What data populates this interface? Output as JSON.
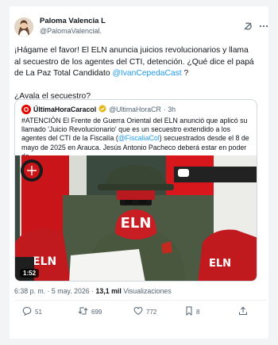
{
  "author": {
    "display_name": "Paloma Valencia L",
    "handle": "@PalomaValencial."
  },
  "tweet": {
    "text_part1": "¡Hágame el favor! El ELN anuncia juicios revolucionarios y llama al secuestro de los agentes del CTI, detención. ¿Qué dice el papá de La Paz Total Candidato ",
    "mention": "@IvanCepedaCast",
    "text_part1_end": " ?",
    "text_part2": "¿Avala el secuestro?"
  },
  "quote": {
    "name": "ÚltimaHoraCaracol",
    "handle": "@UltimaHoraCR",
    "time": "· 3h",
    "text_a": "#ATENCIÓN El Frente de Guerra Oriental del ELN anunció que aplicó su llamado 'Juicio Revolucionario' que es un secuestro extendido a los agentes del CTI de la Fiscalía (",
    "mention": "@FiscaliaCol",
    "text_b": ") secuestrados desde el 8 de mayo de 2025 en Arauca. Jesús Antonio Pacheco deberá estar en poder de",
    "video_duration": "1:52",
    "video_patch_text": "ELN"
  },
  "meta": {
    "time_date": "6:38 p. m. · 5 may. 2026 · ",
    "views_count": "13,1 mil",
    "views_label": "Visualizaciones"
  },
  "actions": {
    "replies": "51",
    "reposts": "699",
    "likes": "772",
    "bookmarks": "8"
  },
  "colors": {
    "accent": "#1d9bf0",
    "secondary_text": "#536471",
    "border": "#cfd9de"
  }
}
